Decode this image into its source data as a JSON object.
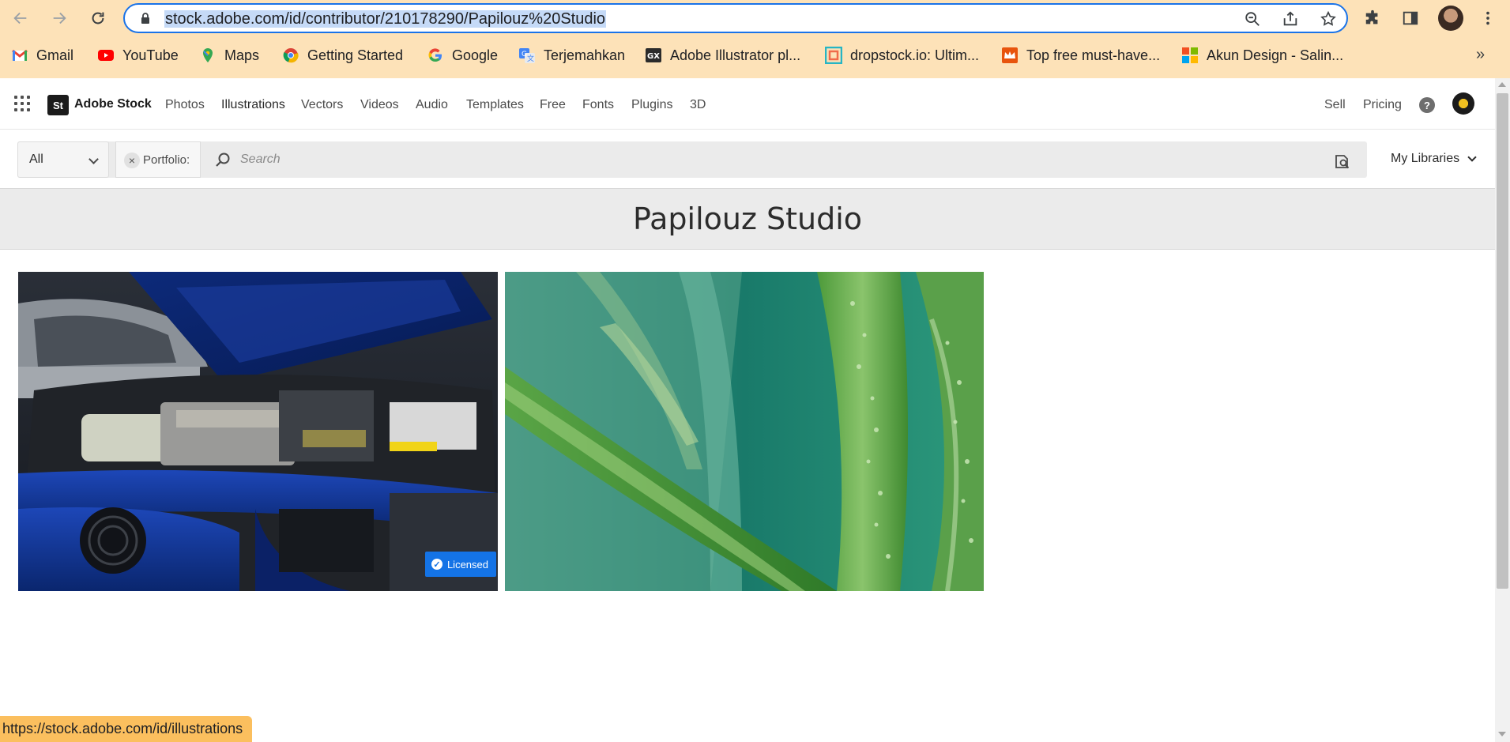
{
  "browser": {
    "url": "stock.adobe.com/id/contributor/210178290/Papilouz%20Studio",
    "bookmarks": [
      {
        "label": "Gmail",
        "icon": "gmail-icon"
      },
      {
        "label": "YouTube",
        "icon": "youtube-icon"
      },
      {
        "label": "Maps",
        "icon": "maps-icon"
      },
      {
        "label": "Getting Started",
        "icon": "chrome-icon"
      },
      {
        "label": "Google",
        "icon": "google-icon"
      },
      {
        "label": "Terjemahkan",
        "icon": "translate-icon"
      },
      {
        "label": "Adobe Illustrator pl...",
        "icon": "illustrator-icon"
      },
      {
        "label": "dropstock.io: Ultim...",
        "icon": "dropstock-icon"
      },
      {
        "label": "Top free must-have...",
        "icon": "crown-icon"
      },
      {
        "label": "Akun Design - Salin...",
        "icon": "microsoft-icon"
      }
    ],
    "more_label": "»",
    "status_url": "https://stock.adobe.com/id/illustrations"
  },
  "stock": {
    "brand": "Adobe Stock",
    "logo_text": "St",
    "nav": [
      "Photos",
      "Illustrations",
      "Vectors",
      "Videos",
      "Audio",
      "Templates",
      "Free",
      "Fonts",
      "Plugins",
      "3D"
    ],
    "sell": "Sell",
    "pricing": "Pricing",
    "help": "?"
  },
  "search": {
    "scope": "All",
    "chip_label": "Portfolio:",
    "chip_close": "×",
    "placeholder": "Search",
    "my_libraries": "My Libraries"
  },
  "page": {
    "title": "Papilouz Studio"
  },
  "gallery": {
    "items": [
      {
        "subject": "car-engine",
        "badge": "Licensed",
        "check": "✓"
      },
      {
        "subject": "aloe-vera",
        "badge": ""
      }
    ]
  },
  "colors": {
    "chrome_bg": "#fde2b8",
    "accent": "#1473e6",
    "omnibox_border": "#1a73e8",
    "status_bubble": "#fbbf5e"
  }
}
